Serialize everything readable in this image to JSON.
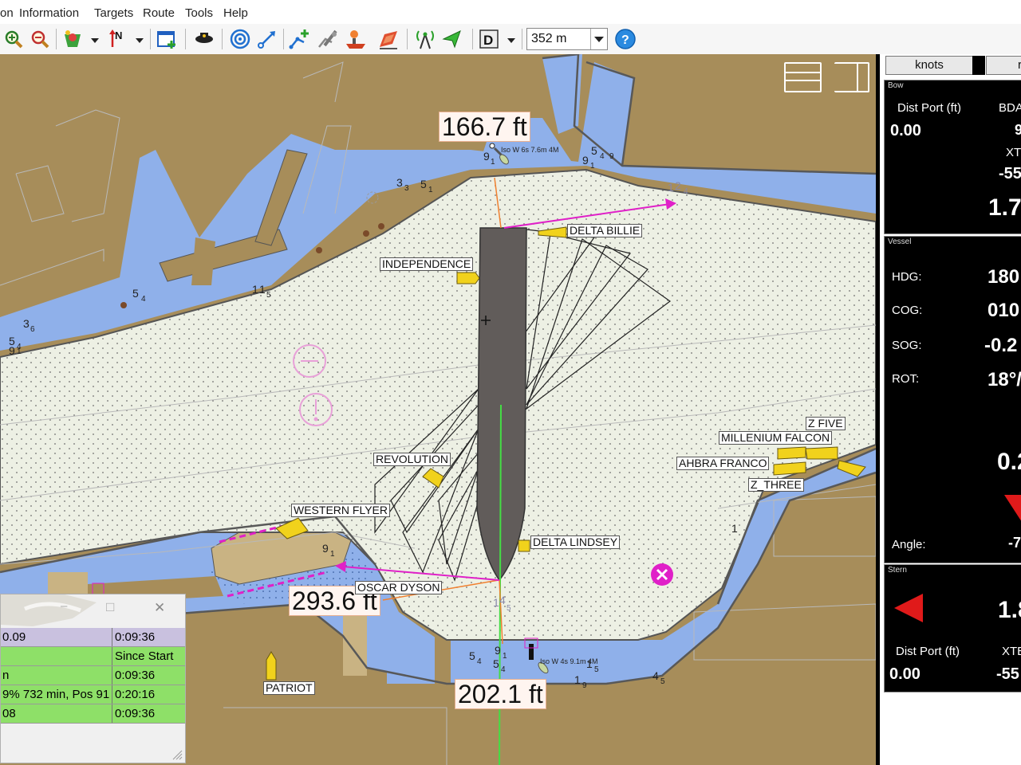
{
  "menu": {
    "m1": "on",
    "m2": "Information",
    "m3": "Targets",
    "m4": "Route",
    "m5": "Tools",
    "m6": "Help"
  },
  "toolbar": {
    "range_value": "352 m",
    "icons": [
      "zoom-in-icon",
      "zoom-out-icon",
      "layers-icon",
      "north-up-icon",
      "new-window-icon",
      "captain-icon",
      "radar-rings-icon",
      "measure-icon",
      "route-add-icon",
      "route-edit-icon",
      "vessel-tool-icon",
      "ship-add-icon",
      "antenna-icon",
      "target-arrow-icon",
      "display-mode-icon",
      "help-icon"
    ],
    "display_mode_glyph": "D",
    "help_glyph": "?"
  },
  "map": {
    "distances": {
      "top": "166.7 ft",
      "left": "293.6 ft",
      "bottom": "202.1 ft"
    },
    "vessels": {
      "delta_billie": "DELTA BILLIE",
      "independence": "INDEPENDENCE",
      "revolution": "REVOLUTION",
      "western_flyer": "WESTERN FLYER",
      "delta_lindsey": "DELTA LINDSEY",
      "oscar_dyson": "OSCAR DYSON",
      "patriot": "PATRIOT",
      "z_five": "Z FIVE",
      "millenium_falcon": "MILLENIUM FALCON",
      "ahbra_franco": "AHBRA FRANCO",
      "z_three": "Z_THREE"
    },
    "light_notes": {
      "north": "Iso W 6s 7.6m 4M",
      "south": "Iso W 4s 9.1m 4M"
    },
    "soundings": [
      "9",
      "1",
      "5",
      "4",
      "9",
      "9",
      "1",
      "3",
      "3",
      "5",
      "1",
      "1",
      "2",
      "4",
      "5",
      "4",
      "1",
      "1",
      "5",
      "3",
      "6",
      "5",
      "4",
      "9",
      "1",
      "9",
      "1",
      "1",
      "4",
      "5",
      "5",
      "4",
      "9",
      "1",
      "5",
      "4",
      "1",
      "9",
      "1",
      "5",
      "4",
      "5",
      "1"
    ]
  },
  "right_panel": {
    "tab_knots": "knots",
    "tab_second": "r",
    "bow": {
      "title": "Bow",
      "dist_port_label": "Dist Port (ft)",
      "dist_port_value": "0.00",
      "bda_label": "BDA",
      "bda_value": "9",
      "xt_label": "XT",
      "xt_value": "-55",
      "speed_value": "1.7"
    },
    "vessel": {
      "title": "Vessel",
      "hdg_label": "HDG:",
      "hdg_value": "180",
      "cog_label": "COG:",
      "cog_value": "010",
      "sog_label": "SOG:",
      "sog_value": "-0.2",
      "rot_label": "ROT:",
      "rot_value": "18°/",
      "big_value": "0.2",
      "angle_label": "Angle:",
      "angle_value": "-7"
    },
    "stern": {
      "title": "Stern",
      "speed_value": "1.8",
      "dist_port_label": "Dist Port (ft)",
      "dist_port_value": "0.00",
      "xte_label": "XTE",
      "xte_value": "-55"
    }
  },
  "dialog": {
    "minimize_glyph": "–",
    "maximize_glyph": "□",
    "close_glyph": "✕",
    "rows": [
      {
        "c1": "0.09",
        "c2": "0:09:36"
      },
      {
        "c1": "",
        "c2": "Since Start"
      },
      {
        "c1": "n",
        "c2": "0:09:36"
      },
      {
        "c1": "9% 732 min, Pos 91",
        "c2": "0:20:16"
      },
      {
        "c1": "08",
        "c2": "0:09:36"
      }
    ]
  },
  "colors": {
    "land": "#a78d5a",
    "water": "#8fb0ea",
    "safe_water": "#edf0e4",
    "own_ship": "#615c5a",
    "vector": "#e020c8",
    "target": "#f1d21c",
    "panel_bg": "#000000",
    "dialog_green": "#8ee068",
    "dialog_purple": "#c9c1df"
  }
}
